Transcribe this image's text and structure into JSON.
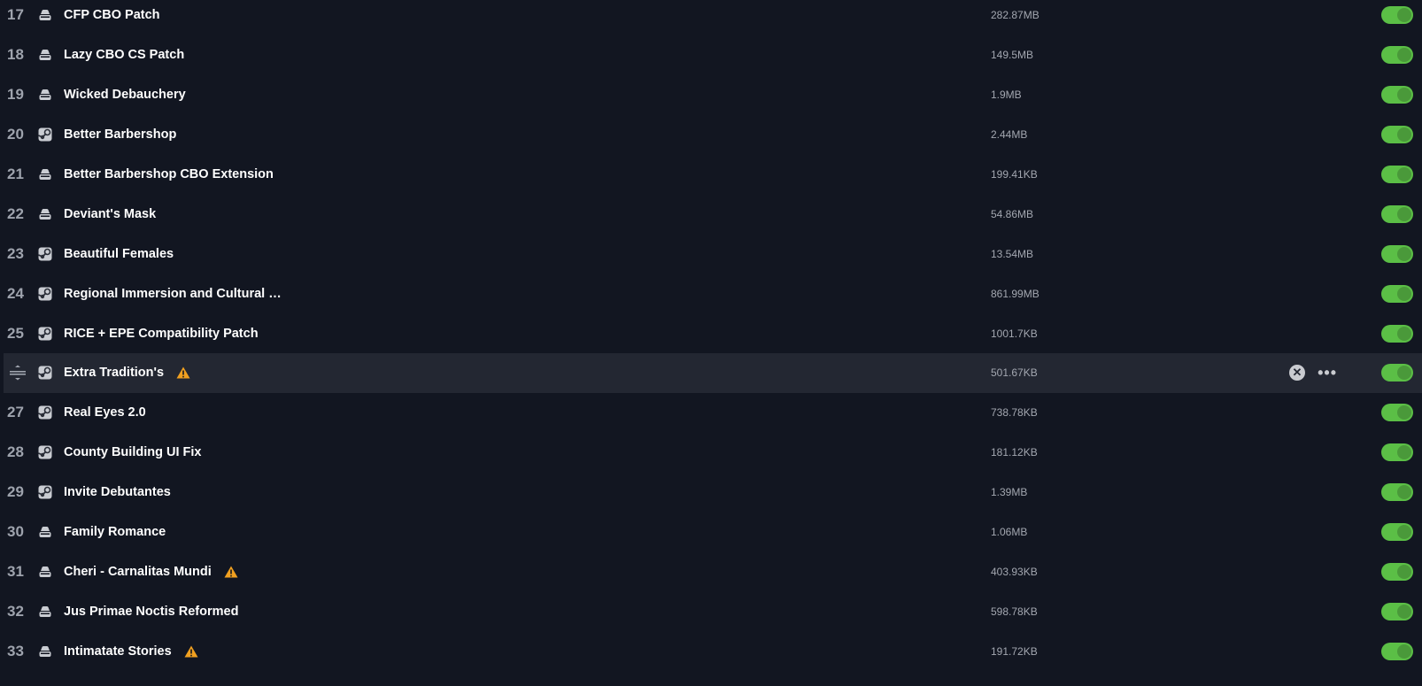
{
  "colors": {
    "background": "#121621",
    "hover_row": "#232732",
    "toggle_on": "#5bbf46",
    "warning": "#f0a020"
  },
  "mods": [
    {
      "index": "17",
      "source": "local",
      "name": "CFP CBO Patch",
      "size": "282.87MB",
      "enabled": true,
      "warning": false
    },
    {
      "index": "18",
      "source": "local",
      "name": "Lazy CBO CS Patch",
      "size": "149.5MB",
      "enabled": true,
      "warning": false
    },
    {
      "index": "19",
      "source": "local",
      "name": "Wicked Debauchery",
      "size": "1.9MB",
      "enabled": true,
      "warning": false
    },
    {
      "index": "20",
      "source": "steam",
      "name": "Better Barbershop",
      "size": "2.44MB",
      "enabled": true,
      "warning": false
    },
    {
      "index": "21",
      "source": "local",
      "name": "Better Barbershop CBO Extension",
      "size": "199.41KB",
      "enabled": true,
      "warning": false
    },
    {
      "index": "22",
      "source": "local",
      "name": "Deviant's Mask",
      "size": "54.86MB",
      "enabled": true,
      "warning": false
    },
    {
      "index": "23",
      "source": "steam",
      "name": "Beautiful Females",
      "size": "13.54MB",
      "enabled": true,
      "warning": false
    },
    {
      "index": "24",
      "source": "steam",
      "name": "Regional Immersion and Cultural …",
      "size": "861.99MB",
      "enabled": true,
      "warning": false
    },
    {
      "index": "25",
      "source": "steam",
      "name": "RICE + EPE Compatibility Patch",
      "size": "1001.7KB",
      "enabled": true,
      "warning": false
    },
    {
      "index": "26",
      "source": "steam",
      "name": "Extra Tradition's",
      "size": "501.67KB",
      "enabled": true,
      "warning": true,
      "hovered": true
    },
    {
      "index": "27",
      "source": "steam",
      "name": "Real Eyes 2.0",
      "size": "738.78KB",
      "enabled": true,
      "warning": false
    },
    {
      "index": "28",
      "source": "steam",
      "name": "County Building UI Fix",
      "size": "181.12KB",
      "enabled": true,
      "warning": false
    },
    {
      "index": "29",
      "source": "steam",
      "name": "Invite Debutantes",
      "size": "1.39MB",
      "enabled": true,
      "warning": false
    },
    {
      "index": "30",
      "source": "local",
      "name": "Family Romance",
      "size": "1.06MB",
      "enabled": true,
      "warning": false
    },
    {
      "index": "31",
      "source": "local",
      "name": "Cheri - Carnalitas Mundi",
      "size": "403.93KB",
      "enabled": true,
      "warning": true
    },
    {
      "index": "32",
      "source": "local",
      "name": "Jus Primae Noctis Reformed",
      "size": "598.78KB",
      "enabled": true,
      "warning": false
    },
    {
      "index": "33",
      "source": "local",
      "name": "Intimatate Stories",
      "size": "191.72KB",
      "enabled": true,
      "warning": true
    }
  ],
  "icons": {
    "local": "hard-drive-icon",
    "steam": "steam-icon",
    "warning": "warning-icon",
    "drag": "drag-handle-icon",
    "remove": "close-circle-icon",
    "more": "more-horizontal-icon"
  },
  "hover_actions": {
    "remove": "✕",
    "more": "•••"
  }
}
